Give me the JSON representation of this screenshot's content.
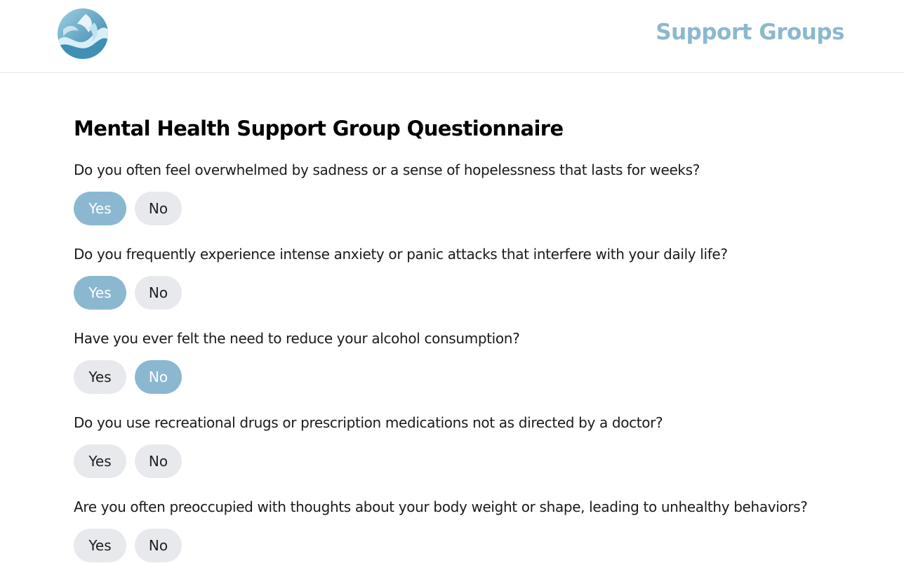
{
  "header": {
    "logo_icon": "wave-logo-icon",
    "nav_title": "Support Groups",
    "accent_color": "#8bb8d0"
  },
  "main": {
    "title": "Mental Health Support Group Questionnaire",
    "questions": [
      {
        "text": "Do you often feel overwhelmed by sadness or a sense of hopelessness that lasts for weeks?",
        "yes_label": "Yes",
        "no_label": "No",
        "selected": "Yes"
      },
      {
        "text": "Do you frequently experience intense anxiety or panic attacks that interfere with your daily life?",
        "yes_label": "Yes",
        "no_label": "No",
        "selected": "Yes"
      },
      {
        "text": "Have you ever felt the need to reduce your alcohol consumption?",
        "yes_label": "Yes",
        "no_label": "No",
        "selected": "No"
      },
      {
        "text": "Do you use recreational drugs or prescription medications not as directed by a doctor?",
        "yes_label": "Yes",
        "no_label": "No",
        "selected": null
      },
      {
        "text": "Are you often preoccupied with thoughts about your body weight or shape, leading to unhealthy behaviors?",
        "yes_label": "Yes",
        "no_label": "No",
        "selected": null
      }
    ]
  },
  "colors": {
    "selected_button": "#8bb8d0",
    "unselected_button": "#e8e9ed",
    "divider": "#e6e6e6"
  }
}
